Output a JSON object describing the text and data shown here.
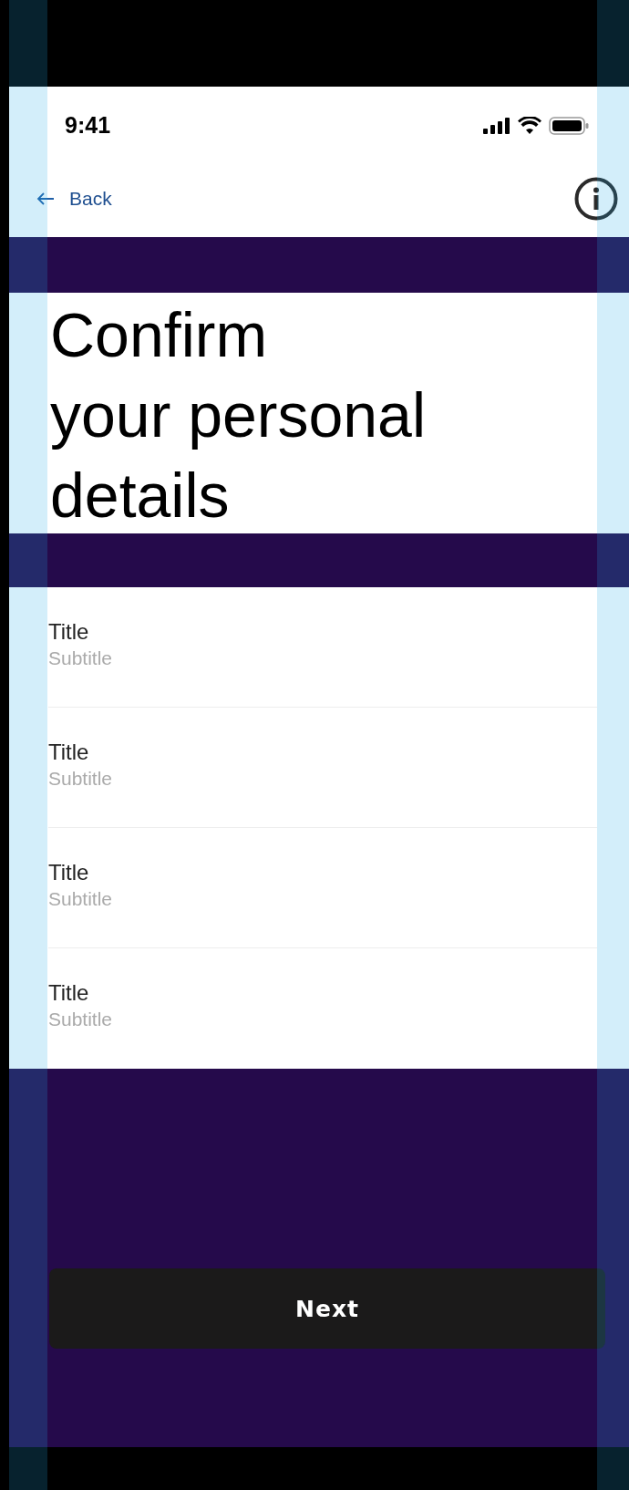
{
  "status_bar": {
    "time": "9:41"
  },
  "nav": {
    "back_label": "Back"
  },
  "heading": {
    "lines": [
      "Confirm",
      "your personal",
      "details"
    ]
  },
  "list": [
    {
      "title": "Title",
      "subtitle": "Subtitle"
    },
    {
      "title": "Title",
      "subtitle": "Subtitle"
    },
    {
      "title": "Title",
      "subtitle": "Subtitle"
    },
    {
      "title": "Title",
      "subtitle": "Subtitle"
    }
  ],
  "button": {
    "label": "Next"
  }
}
